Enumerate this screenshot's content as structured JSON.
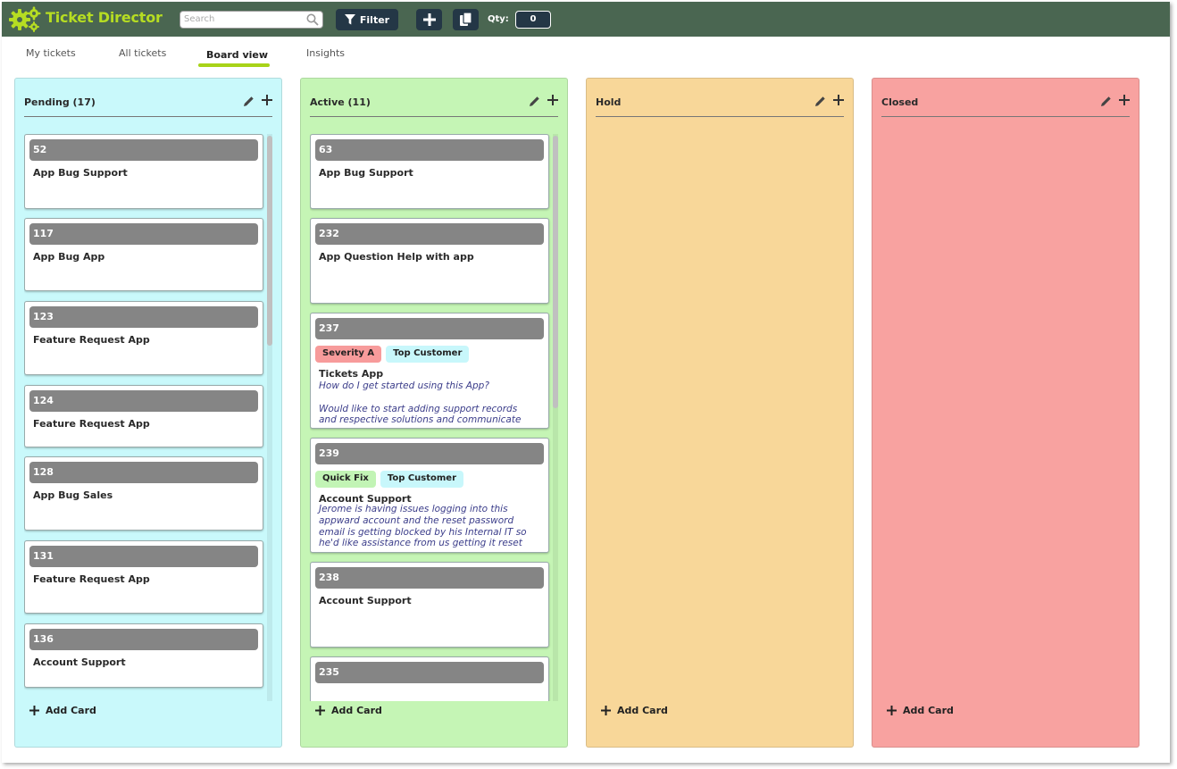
{
  "app": {
    "title": "Ticket Director",
    "brand_color": "#b6dd22",
    "header_bg": "#4a6651"
  },
  "toolbar": {
    "search_placeholder": "Search",
    "filter_label": "Filter",
    "qty_label": "Qty:",
    "qty_value": "0"
  },
  "tabs": [
    {
      "label": "My tickets"
    },
    {
      "label": "All tickets"
    },
    {
      "label": "Board view",
      "active": true
    },
    {
      "label": "Insights"
    }
  ],
  "columns": [
    {
      "title": "Pending (17)",
      "bg": "#c9f9fb",
      "add_card_label": "Add Card",
      "cards": [
        {
          "id": "52",
          "title": "App Bug Support"
        },
        {
          "id": "117",
          "title": "App Bug App"
        },
        {
          "id": "123",
          "title": "Feature Request App"
        },
        {
          "id": "124",
          "title": "Feature Request App"
        },
        {
          "id": "128",
          "title": "App Bug Sales"
        },
        {
          "id": "131",
          "title": "Feature Request App"
        },
        {
          "id": "136",
          "title": "Account Support"
        }
      ]
    },
    {
      "title": "Active (11)",
      "bg": "#c5f5b5",
      "add_card_label": "Add Card",
      "cards": [
        {
          "id": "63",
          "title": "App Bug Support"
        },
        {
          "id": "232",
          "title": "App Question Help with app"
        },
        {
          "id": "237",
          "tags": [
            "Severity A",
            "Top Customer"
          ],
          "title": "Tickets App",
          "description": "How do I get started using this App?\n\nWould like to start adding support records\nand respective solutions and communicate"
        },
        {
          "id": "239",
          "tags": [
            "Quick Fix",
            "Top Customer"
          ],
          "title": "Account Support",
          "description": "Jerome is having issues logging into this\nappward account and the reset password\nemail is getting blocked by his Internal IT so\nhe'd like assistance from us getting it reset"
        },
        {
          "id": "238",
          "title": "Account Support"
        },
        {
          "id": "235",
          "title": ""
        }
      ]
    },
    {
      "title": "Hold",
      "bg": "#f8d799",
      "add_card_label": "Add Card",
      "cards": []
    },
    {
      "title": "Closed",
      "bg": "#f8a2a0",
      "add_card_label": "Add Card",
      "cards": []
    }
  ]
}
